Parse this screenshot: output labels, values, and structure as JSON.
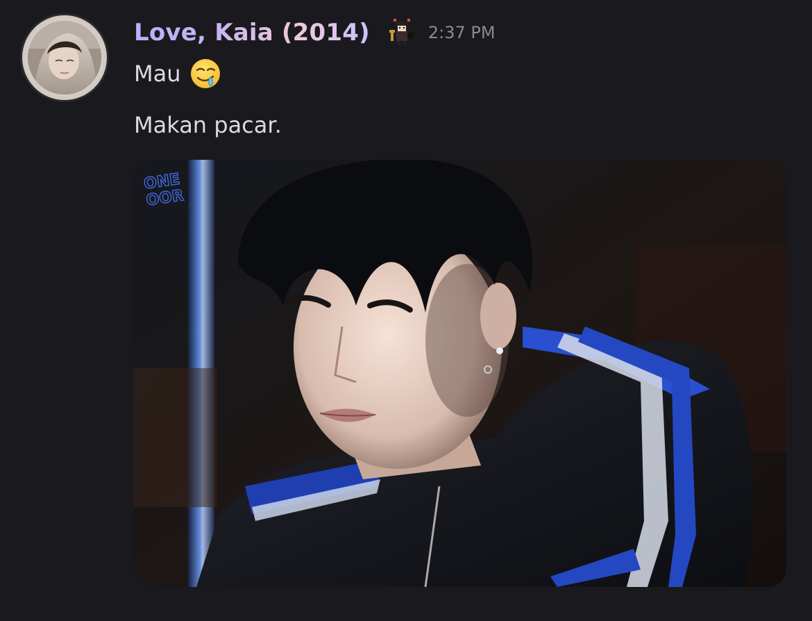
{
  "message": {
    "author": "Love, Kaia (2014)",
    "timestamp": "2:37 PM",
    "lines": [
      {
        "text": "Mau",
        "emoji": "drooling-face"
      },
      {
        "text": "Makan pacar."
      }
    ],
    "attachment": {
      "watermark": "ONE\nOOR"
    }
  },
  "colors": {
    "background": "#1a1a1e",
    "text": "#dbdce0",
    "timestamp": "#8a8b92",
    "username_gradient": [
      "#b9b0ff",
      "#f0c9d8"
    ]
  }
}
